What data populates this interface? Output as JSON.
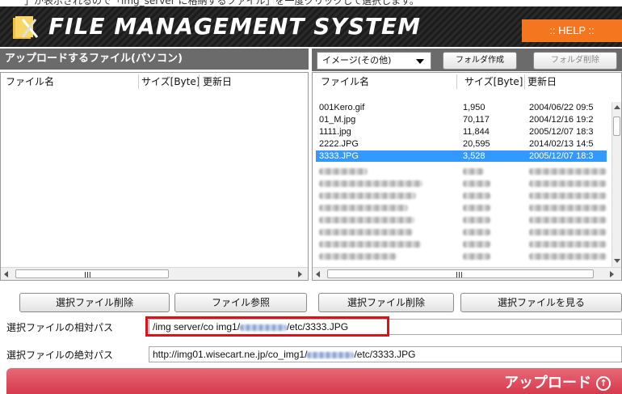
{
  "top_text": "」が表示されるので「img_server に格納するファイル」を一度クリックして選択します。",
  "header": {
    "app_title": "FILE MANAGEMENT SYSTEM",
    "help_label": ":: HELP ::"
  },
  "colors": {
    "header_bg": "#222222",
    "help_btn": "#f4761f",
    "selected_row": "#3399ff",
    "highlight_border": "#e0101a",
    "upload_bar": "#d7394d"
  },
  "left_panel": {
    "title": "アップロードするファイル(パソコン)",
    "columns": [
      "ファイル名",
      "サイズ[Byte]",
      "更新日"
    ],
    "scroll_label": "III",
    "buttons": {
      "delete": "選択ファイル削除",
      "browse": "ファイル参照"
    }
  },
  "right_panel": {
    "folder_select": "イメージ(その他)",
    "create_folder": "フォルダ作成",
    "delete_folder": "フォルダ削除",
    "columns": [
      "ファイル名",
      "サイズ[Byte]",
      "更新日"
    ],
    "files": [
      {
        "name": "001Kero.gif",
        "size": "1,950",
        "date": "2004/06/22 09:5"
      },
      {
        "name": "01_M.jpg",
        "size": "70,117",
        "date": "2004/12/16 19:2"
      },
      {
        "name": "1111.jpg",
        "size": "11,844",
        "date": "2005/12/07 18:3"
      },
      {
        "name": "2222.JPG",
        "size": "20,595",
        "date": "2014/02/13 14:5"
      },
      {
        "name": "3333.JPG",
        "size": "3,528",
        "date": "2005/12/07 18:3"
      }
    ],
    "scroll_label": "III",
    "buttons": {
      "delete": "選択ファイル削除",
      "view": "選択ファイルを見る"
    }
  },
  "relative_path": {
    "label": "選択ファイルの相対パス",
    "prefix": "/img server/co img1/",
    "suffix": "/etc/3333.JPG"
  },
  "absolute_path": {
    "label": "選択ファイルの絶対パス",
    "prefix": "http://img01.wisecart.ne.jp/co_img1/",
    "suffix": "/etc/3333.JPG"
  },
  "upload": {
    "label": "アップロード",
    "icon": "upload-circle-arrow-icon"
  }
}
